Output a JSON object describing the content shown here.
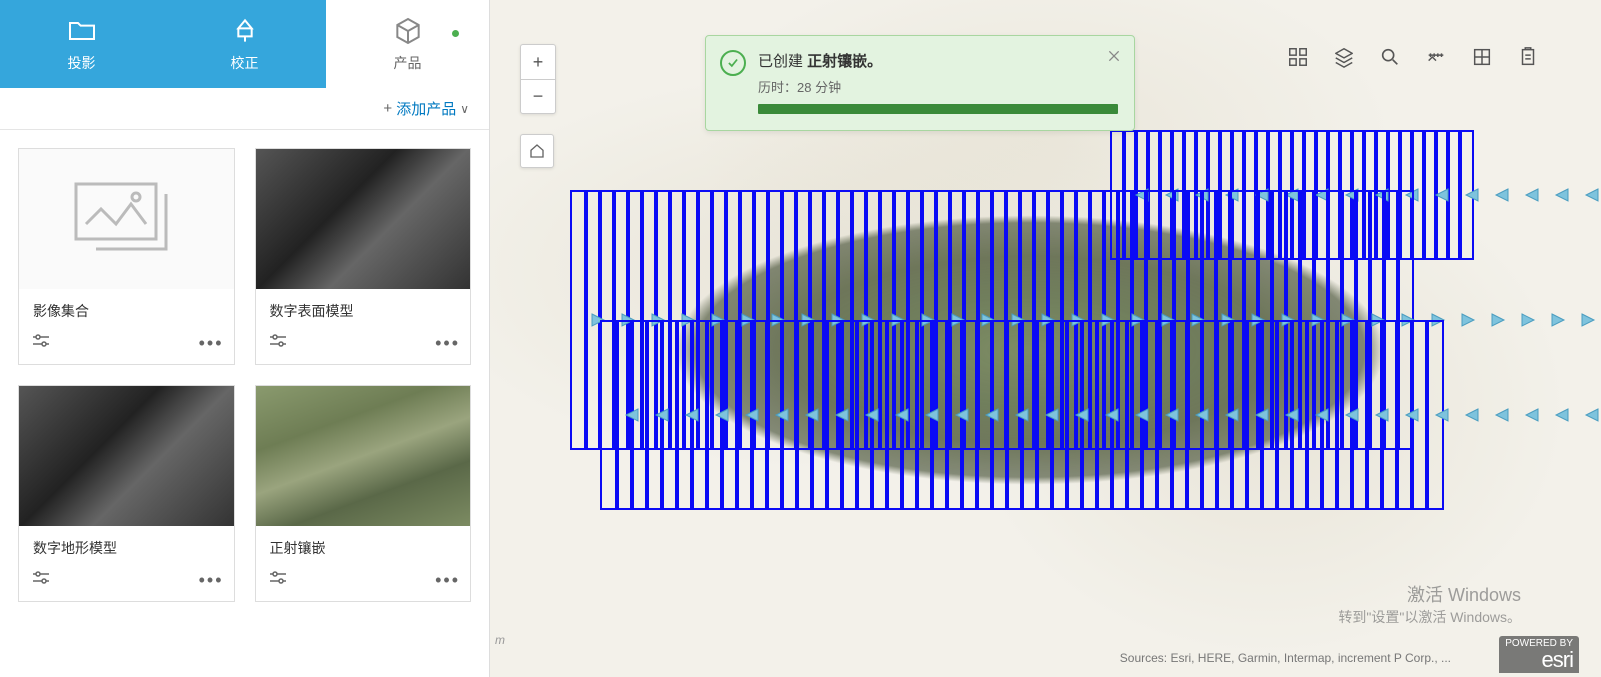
{
  "tabs": [
    {
      "label": "投影",
      "active": true
    },
    {
      "label": "校正",
      "active": true
    },
    {
      "label": "产品",
      "active": false,
      "dot": true
    }
  ],
  "add": {
    "plus": "+",
    "label": "添加产品",
    "chevron": "∨"
  },
  "cards": [
    {
      "title": "影像集合",
      "thumb": "placeholder"
    },
    {
      "title": "数字表面模型",
      "thumb": "dark"
    },
    {
      "title": "数字地形模型",
      "thumb": "dark"
    },
    {
      "title": "正射镶嵌",
      "thumb": "ortho"
    }
  ],
  "toast": {
    "prefix": "已创建 ",
    "bold": "正射镶嵌。",
    "sub_prefix": "历时：",
    "sub_value": "28 分钟"
  },
  "watermark": {
    "line1": "激活 Windows",
    "line2": "转到\"设置\"以激活 Windows。"
  },
  "attrib": "Sources: Esri, HERE, Garmin, Intermap, increment P Corp., ...",
  "esri": {
    "small": "POWERED BY",
    "big": "esri"
  },
  "unit": "m",
  "colors": {
    "accent": "#35A6DC",
    "footprint": "#0a0af5",
    "arrow": "#6ab7d9",
    "success": "#4caf50"
  }
}
